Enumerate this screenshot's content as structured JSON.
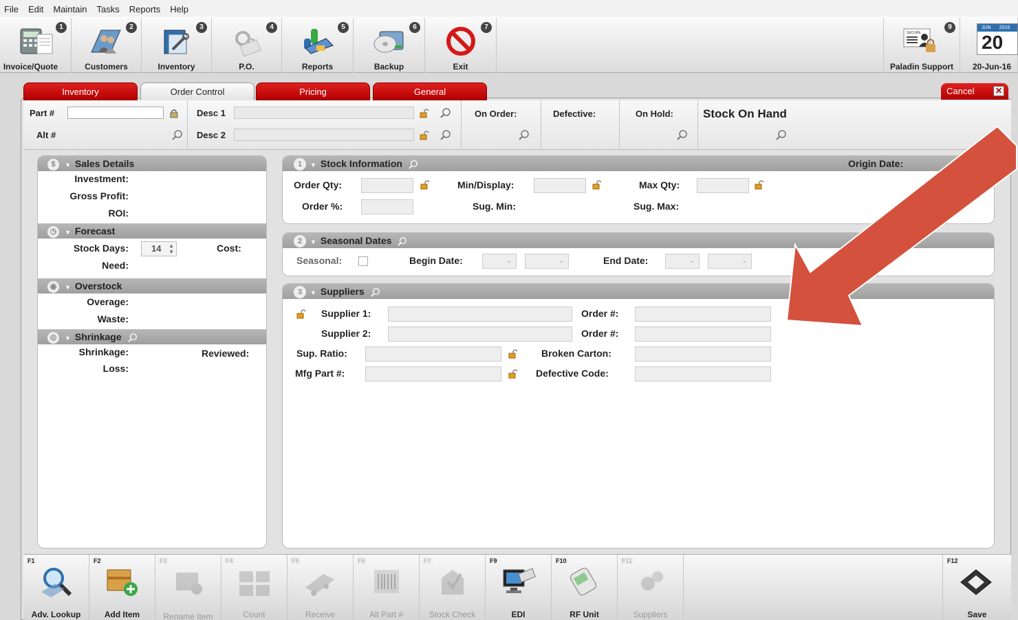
{
  "menu": [
    "File",
    "Edit",
    "Maintain",
    "Tasks",
    "Reports",
    "Help"
  ],
  "toolbar": {
    "buttons": [
      {
        "num": "1",
        "label": "Invoice/Quote",
        "icon": "calculator-icon"
      },
      {
        "num": "2",
        "label": "Customers",
        "icon": "customers-icon"
      },
      {
        "num": "3",
        "label": "Inventory",
        "icon": "inventory-tools-icon"
      },
      {
        "num": "4",
        "label": "P.O.",
        "icon": "purchase-order-icon"
      },
      {
        "num": "5",
        "label": "Reports",
        "icon": "reports-chart-icon"
      },
      {
        "num": "6",
        "label": "Backup",
        "icon": "backup-disc-icon"
      },
      {
        "num": "7",
        "label": "Exit",
        "icon": "exit-prohibited-icon"
      }
    ],
    "support": {
      "num": "9",
      "label": "Paladin Support",
      "icon": "secure-support-icon",
      "badge": "SECURE"
    },
    "date": {
      "month": "JUN",
      "year": "2016",
      "day": "20",
      "label": "20-Jun-16"
    }
  },
  "tabs": [
    "Inventory",
    "Order Control",
    "Pricing",
    "General"
  ],
  "active_tab": "Order Control",
  "cancel_label": "Cancel",
  "header": {
    "part_label": "Part #",
    "alt_label": "Alt #",
    "desc1_label": "Desc 1",
    "desc2_label": "Desc 2",
    "on_order": "On Order:",
    "defective": "Defective:",
    "on_hold": "On Hold:",
    "stock_on_hand": "Stock On Hand"
  },
  "left": {
    "sales": {
      "title": "Sales Details",
      "investment": "Investment:",
      "gross_profit": "Gross Profit:",
      "roi": "ROI:"
    },
    "forecast": {
      "title": "Forecast",
      "stock_days": "Stock Days:",
      "stock_days_value": "14",
      "cost": "Cost:",
      "need": "Need:"
    },
    "overstock": {
      "title": "Overstock",
      "overage": "Overage:",
      "waste": "Waste:"
    },
    "shrinkage": {
      "title": "Shrinkage",
      "shrinkage": "Shrinkage:",
      "reviewed": "Reviewed:",
      "loss": "Loss:"
    }
  },
  "stock_info": {
    "num": "1",
    "title": "Stock Information",
    "origin_date": "Origin Date:",
    "order_qty": "Order Qty:",
    "min_display": "Min/Display:",
    "max_qty": "Max Qty:",
    "order_pct": "Order %:",
    "sug_min": "Sug. Min:",
    "sug_max": "Sug. Max:"
  },
  "seasonal": {
    "num": "2",
    "title": "Seasonal Dates",
    "seasonal": "Seasonal:",
    "begin_date": "Begin Date:",
    "end_date": "End Date:"
  },
  "suppliers": {
    "num": "3",
    "title": "Suppliers",
    "supplier1": "Supplier 1:",
    "supplier2": "Supplier 2:",
    "order_no1": "Order #:",
    "order_no2": "Order #:",
    "sup_ratio": "Sup. Ratio:",
    "broken_carton": "Broken Carton:",
    "mfg_part": "Mfg Part #:",
    "defective_code": "Defective Code:"
  },
  "fkeys": [
    {
      "key": "F1",
      "label": "Adv. Lookup",
      "enabled": true,
      "icon": "magnifier-icon"
    },
    {
      "key": "F2",
      "label": "Add Item",
      "enabled": true,
      "icon": "add-box-icon"
    },
    {
      "key": "F3",
      "label": "Rename Item",
      "enabled": false,
      "icon": "rename-icon"
    },
    {
      "key": "F4",
      "label": "Count",
      "enabled": false,
      "icon": "count-icon"
    },
    {
      "key": "F5",
      "label": "Receive",
      "enabled": false,
      "icon": "truck-icon"
    },
    {
      "key": "F6",
      "label": "Alt Part #",
      "enabled": false,
      "icon": "barcode-icon"
    },
    {
      "key": "F7",
      "label": "Stock Check",
      "enabled": false,
      "icon": "stock-check-icon"
    },
    {
      "key": "F9",
      "label": "EDI",
      "enabled": true,
      "icon": "edi-computer-icon"
    },
    {
      "key": "F10",
      "label": "RF Unit",
      "enabled": true,
      "icon": "rf-unit-icon"
    },
    {
      "key": "F11",
      "label": "Suppliers",
      "enabled": false,
      "icon": "suppliers-gears-icon"
    },
    {
      "key": "F12",
      "label": "Save",
      "enabled": true,
      "icon": "save-disk-icon"
    }
  ],
  "colors": {
    "tab_red": "#c40000",
    "arrow": "#d4513d",
    "section_gray": "#a8a8a8"
  }
}
